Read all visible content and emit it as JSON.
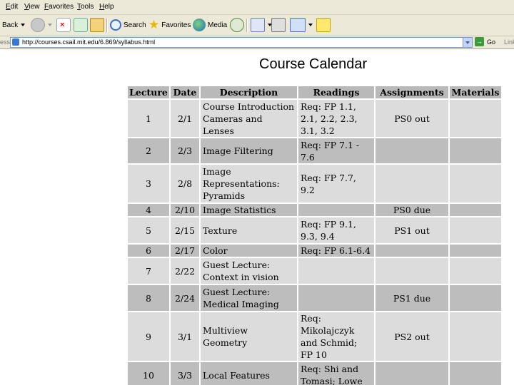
{
  "menu": [
    {
      "key": "E",
      "rest": "dit"
    },
    {
      "key": "V",
      "rest": "iew"
    },
    {
      "key": "F",
      "rest": "avorites"
    },
    {
      "key": "T",
      "rest": "ools"
    },
    {
      "key": "H",
      "rest": "elp"
    }
  ],
  "toolbar": {
    "back_label": "Back",
    "search_label": "Search",
    "favorites_label": "Favorites",
    "media_label": "Media"
  },
  "address": {
    "label": "ess",
    "url": "http://courses.csail.mit.edu/6.869/syllabus.html",
    "go_label": "Go",
    "links_label": "Link"
  },
  "colors": {
    "chrome": "#ece9d8",
    "header_bg": "#b9b9b9",
    "row_light": "#dcdcdc",
    "row_dark": "#bdbdbd"
  },
  "page": {
    "title": "Course Calendar",
    "columns": [
      "Lecture",
      "Date",
      "Description",
      "Readings",
      "Assignments",
      "Materials"
    ],
    "rows": [
      {
        "lecture": "1",
        "date": "2/1",
        "description": "Course Introduction Cameras and Lenses",
        "readings": "Req: FP 1.1, 2.1, 2.2, 2.3, 3.1, 3.2",
        "assignments": "PS0 out",
        "materials": ""
      },
      {
        "lecture": "2",
        "date": "2/3",
        "description": "Image Filtering",
        "readings": "Req: FP 7.1 - 7.6",
        "assignments": "",
        "materials": ""
      },
      {
        "lecture": "3",
        "date": "2/8",
        "description": "Image Representations: Pyramids",
        "readings": "Req: FP 7.7, 9.2",
        "assignments": "",
        "materials": ""
      },
      {
        "lecture": "4",
        "date": "2/10",
        "description": "Image Statistics",
        "readings": "",
        "assignments": "PS0 due",
        "materials": ""
      },
      {
        "lecture": "5",
        "date": "2/15",
        "description": "Texture",
        "readings": "Req: FP 9.1, 9.3, 9.4",
        "assignments": "PS1 out",
        "materials": ""
      },
      {
        "lecture": "6",
        "date": "2/17",
        "description": "Color",
        "readings": "Req: FP 6.1-6.4",
        "assignments": "",
        "materials": ""
      },
      {
        "lecture": "7",
        "date": "2/22",
        "description": "Guest Lecture: Context in vision",
        "readings": "",
        "assignments": "",
        "materials": ""
      },
      {
        "lecture": "8",
        "date": "2/24",
        "description": "Guest Lecture: Medical Imaging",
        "readings": "",
        "assignments": "PS1 due",
        "materials": ""
      },
      {
        "lecture": "9",
        "date": "3/1",
        "description": "Multiview Geometry",
        "readings": "Req: Mikolajczyk and Schmid; FP 10",
        "assignments": "PS2 out",
        "materials": ""
      },
      {
        "lecture": "10",
        "date": "3/3",
        "description": "Local Features",
        "readings": "Req: Shi and Tomasi; Lowe",
        "assignments": "",
        "materials": ""
      }
    ]
  }
}
